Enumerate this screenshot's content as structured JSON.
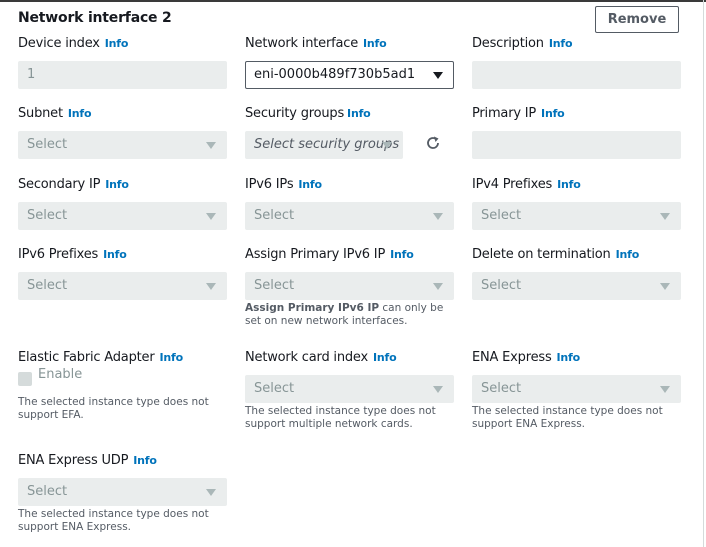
{
  "title": "Network interface 2",
  "remove_label": "Remove",
  "info_label": "Info",
  "fields": {
    "device_index": {
      "label": "Device index",
      "value": "1"
    },
    "network_interface": {
      "label": "Network interface",
      "value": "eni-0000b489f730b5ad1"
    },
    "description": {
      "label": "Description",
      "value": ""
    },
    "subnet": {
      "label": "Subnet",
      "value": "Select"
    },
    "security_groups": {
      "label": "Security groups",
      "value": "Select security groups"
    },
    "primary_ip": {
      "label": "Primary IP",
      "value": ""
    },
    "secondary_ip": {
      "label": "Secondary IP",
      "value": "Select"
    },
    "ipv6_ips": {
      "label": "IPv6 IPs",
      "value": "Select"
    },
    "ipv4_prefixes": {
      "label": "IPv4 Prefixes",
      "value": "Select"
    },
    "ipv6_prefixes": {
      "label": "IPv6 Prefixes",
      "value": "Select"
    },
    "assign_primary_ipv6": {
      "label": "Assign Primary IPv6 IP",
      "value": "Select",
      "note_bold": "Assign Primary IPv6 IP",
      "note_rest": " can only be set on new network interfaces."
    },
    "delete_on_termination": {
      "label": "Delete on termination",
      "value": "Select"
    },
    "efa": {
      "label": "Elastic Fabric Adapter",
      "checkbox_label": "Enable",
      "note": "The selected instance type does not support EFA."
    },
    "network_card_index": {
      "label": "Network card index",
      "value": "Select",
      "note": "The selected instance type does not support multiple network cards."
    },
    "ena_express": {
      "label": "ENA Express",
      "value": "Select",
      "note": "The selected instance type does not support ENA Express."
    },
    "ena_express_udp": {
      "label": "ENA Express UDP",
      "value": "Select",
      "note": "The selected instance type does not support ENA Express."
    }
  }
}
